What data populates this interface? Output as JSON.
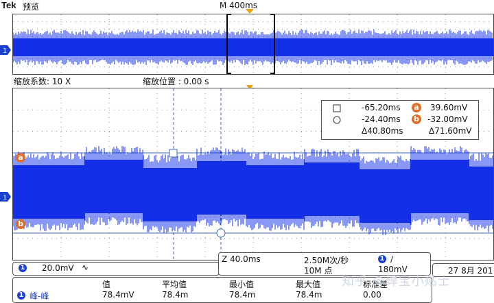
{
  "header": {
    "brand": "Tek",
    "mode": "预览",
    "horizontal_scale": "M 400ms"
  },
  "zoom": {
    "factor_label": "缩放系数: 10 X",
    "position_label": "缩放位置 : 0.00 s"
  },
  "colors": {
    "waveform": "#1330e8",
    "grid": "#8a8a8a",
    "cursor": "#3b66b8",
    "badge": "#e36d26",
    "channel": "#1b3fcf",
    "trigger": "#f2a10c"
  },
  "channel": {
    "marker": "1"
  },
  "cursor_readout": {
    "square_time": "-65.20ms",
    "circle_time": "-24.40ms",
    "delta_time": "Δ40.80ms",
    "a_marker": "a",
    "a_value": "39.60mV",
    "b_marker": "b",
    "b_value": "-32.00mV",
    "delta_value": "Δ71.60mV"
  },
  "bottom": {
    "ch_badge": "1",
    "ch_scale": "20.0mV",
    "coupling_icon": "∿",
    "zoom_time": "Z 40.0ms",
    "sample_rate": "2.50M次/秒",
    "points": "10M 点",
    "trig_badge": "1",
    "trig_slope": "∕",
    "trig_level": "180mV",
    "date": "27 8月 201"
  },
  "measurements": {
    "headers": [
      "值",
      "平均值",
      "最小值",
      "最大值",
      "标准差"
    ],
    "row_badge": "1",
    "row_label": "峰-峰",
    "values": [
      "78.4mV",
      "78.4m",
      "78.4m",
      "78.4m",
      "0.00"
    ]
  },
  "watermark": "知乎 @焊宝小贴士"
}
